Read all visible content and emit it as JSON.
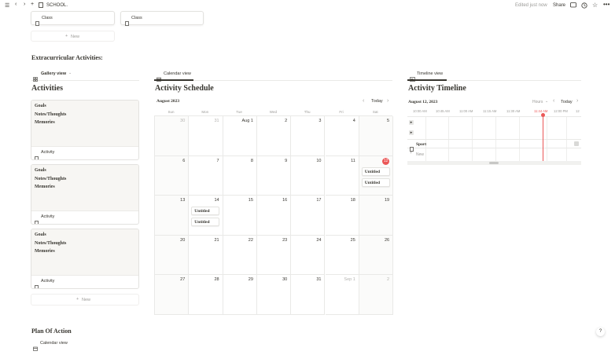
{
  "topbar": {
    "breadcrumb": "SCHOOL.",
    "edited": "Edited just now",
    "share": "Share"
  },
  "top_cards": [
    {
      "title": "Class"
    },
    {
      "title": "Class"
    }
  ],
  "top_new": "New",
  "section_title": "Extracurricular Activities:",
  "gallery": {
    "view_label": "Gallery view",
    "title": "Activities",
    "cards": [
      {
        "lines": [
          "Goals",
          "Notes/Thoughts",
          "Memories"
        ],
        "name": "Activity"
      },
      {
        "lines": [
          "Goals",
          "Notes/Thoughts",
          "Memories"
        ],
        "name": "Activity"
      },
      {
        "lines": [
          "Goals",
          "Notes/Thoughts",
          "Memories"
        ],
        "name": "Activity"
      }
    ],
    "new_label": "New"
  },
  "calendar": {
    "view_label": "Calendar view",
    "title": "Activity Schedule",
    "month": "August 2023",
    "today": "Today",
    "weekdays": [
      "Sun",
      "Mon",
      "Tue",
      "Wed",
      "Thu",
      "Fri",
      "Sat"
    ],
    "weeks": [
      [
        "30",
        "31",
        "Aug 1",
        "2",
        "3",
        "4",
        "5"
      ],
      [
        "6",
        "7",
        "8",
        "9",
        "10",
        "11",
        "12"
      ],
      [
        "13",
        "14",
        "15",
        "16",
        "17",
        "18",
        "19"
      ],
      [
        "20",
        "21",
        "22",
        "23",
        "24",
        "25",
        "26"
      ],
      [
        "27",
        "28",
        "29",
        "30",
        "31",
        "Sep 1",
        "2"
      ]
    ],
    "events": {
      "sat12_1": "Untitled",
      "sat12_2": "Untitled",
      "mon14_1": "Untitled",
      "mon14_2": "Untitled"
    }
  },
  "timeline": {
    "view_label": "Timeline view",
    "title": "Activity Timeline",
    "date": "August 12, 2023",
    "scale": "Hours",
    "today": "Today",
    "times": [
      "10:00 AM",
      "10:45 AM",
      "11:00 AM",
      "11:15 AM",
      "11:30 AM",
      "11:44 AM",
      "12:00 PM",
      "12"
    ],
    "row_label": "Sport",
    "new_label": "New"
  },
  "plan": {
    "title": "Plan Of Action",
    "view_label": "Calendar view"
  },
  "help": "?",
  "colors": {
    "accent": "#eb5757",
    "border": "#e9e9e7",
    "text": "#37352f"
  }
}
